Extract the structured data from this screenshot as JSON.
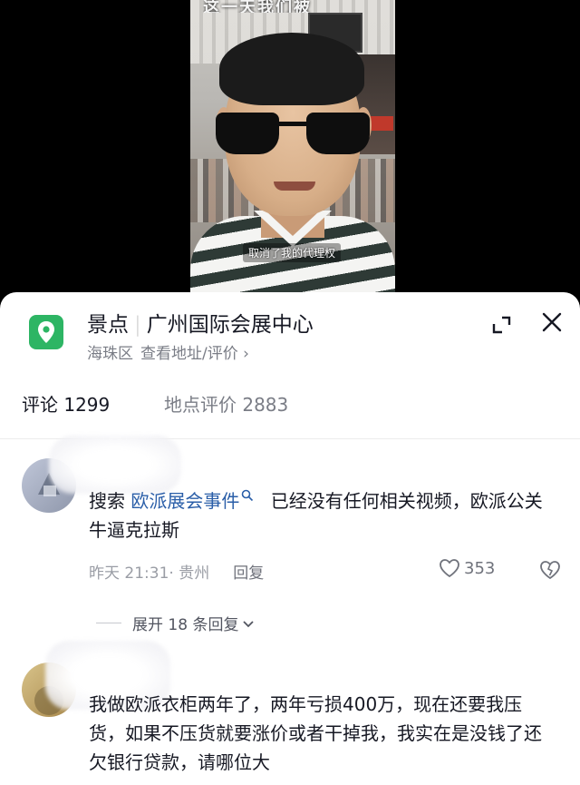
{
  "video": {
    "top_caption": "这一天我们被",
    "subtitle": "取消了我的代理权"
  },
  "location_card": {
    "category": "景点",
    "name": "广州国际会展中心",
    "district": "海珠区",
    "address_link": "查看地址/评价 ›",
    "icons": {
      "pin": "map-pin-icon",
      "expand": "expand-icon",
      "close": "close-icon"
    },
    "accent_color": "#2db564"
  },
  "tabs": [
    {
      "label": "评论 1299",
      "active": true
    },
    {
      "label": "地点评价 2883",
      "active": false
    }
  ],
  "comments": [
    {
      "text_before": "搜索 ",
      "highlight": "欧派展会事件",
      "text_after": " 已经没有任何相关视频，欧派公关 牛逼克拉斯",
      "time": "昨天 21:31",
      "location": "· 贵州",
      "reply_label": "回复",
      "likes": "353",
      "expand_replies": "展开 18 条回复"
    },
    {
      "text": "我做欧派衣柜两年了，两年亏损400万，现在还要我压货，如果不压货就要涨价或者干掉我，我实在是没钱了还欠银行贷款，请哪位大"
    }
  ],
  "colors": {
    "link": "#2a5ea8",
    "muted": "#9a9da5",
    "text": "#161823"
  }
}
